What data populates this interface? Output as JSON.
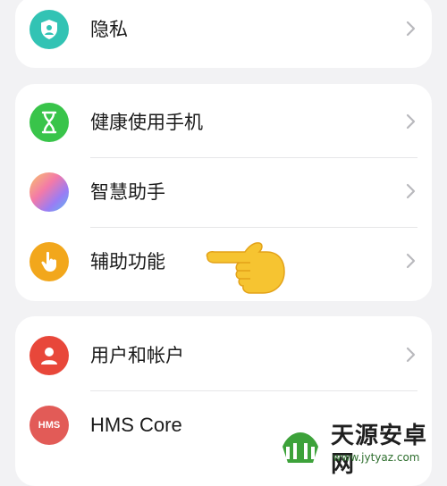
{
  "group1": {
    "privacy_label": "隐私"
  },
  "group2": {
    "digital_balance_label": "健康使用手机",
    "assistant_label": "智慧助手",
    "accessibility_label": "辅助功能"
  },
  "group3": {
    "accounts_label": "用户和帐户",
    "hms_label": "HMS Core",
    "hms_icon_text": "HMS"
  },
  "watermark": {
    "title": "天源安卓网",
    "url": "www.jytyaz.com"
  },
  "colors": {
    "privacy_icon": "#32c3b4",
    "digital_balance_icon": "#39c44a",
    "accessibility_icon": "#f2a71c",
    "accounts_icon": "#e8473a",
    "hms_icon": "#e25b57",
    "pointer_hand": "#f6c431"
  }
}
